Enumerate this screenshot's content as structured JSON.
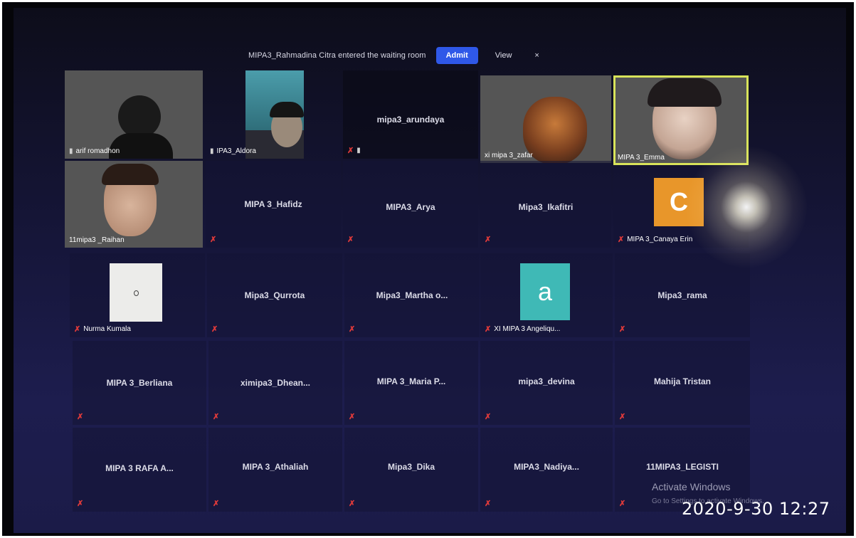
{
  "waiting_room": {
    "message": "MIPA3_Rahmadina Citra entered the waiting room",
    "admit_label": "Admit",
    "view_label": "View",
    "close_label": "×"
  },
  "participants": {
    "arif": "arif romadhon",
    "aldora": "IPA3_Aldora",
    "arundaya": "mipa3_arundaya",
    "zafar": "xi mipa 3_zafar",
    "emma": "MIPA 3_Emma",
    "raihan": "11mipa3 _Raihan",
    "hafidz": "MIPA 3_Hafidz",
    "arya": "MIPA3_Arya",
    "ikafitri": "Mipa3_Ikafitri",
    "canaya": "MIPA 3_Canaya Erin",
    "canaya_initial": "C",
    "nurma": "Nurma Kumala",
    "qurrota": "Mipa3_Qurrota",
    "martha": "Mipa3_Martha o...",
    "angelique": "XI MIPA 3 Angeliqu...",
    "angelique_initial": "a",
    "rama": "Mipa3_rama",
    "berliana": "MIPA 3_Berliana",
    "dhean": "ximipa3_Dhean...",
    "maria": "MIPA 3_Maria P...",
    "devina": "mipa3_devina",
    "tristan": "Mahija Tristan",
    "rafa": "MIPA 3 RAFA A...",
    "athaliah": "MIPA 3_Athaliah",
    "dika": "Mipa3_Dika",
    "nadiya": "MIPA3_Nadiya...",
    "legisti": "11MIPA3_LEGISTI"
  },
  "system": {
    "activate_title": "Activate Windows",
    "activate_sub": "Go to Settings to activate Windows.",
    "timestamp": "2020-9-30 12:27"
  },
  "colors": {
    "admit_button": "#2f58e8",
    "active_speaker_border": "#d8e35a",
    "muted_icon": "#e03a3a",
    "canaya_avatar": "#e8962a",
    "angelique_avatar": "#3fb9b6"
  },
  "icons": [
    "mic-off-icon",
    "pin-icon",
    "close-icon"
  ]
}
